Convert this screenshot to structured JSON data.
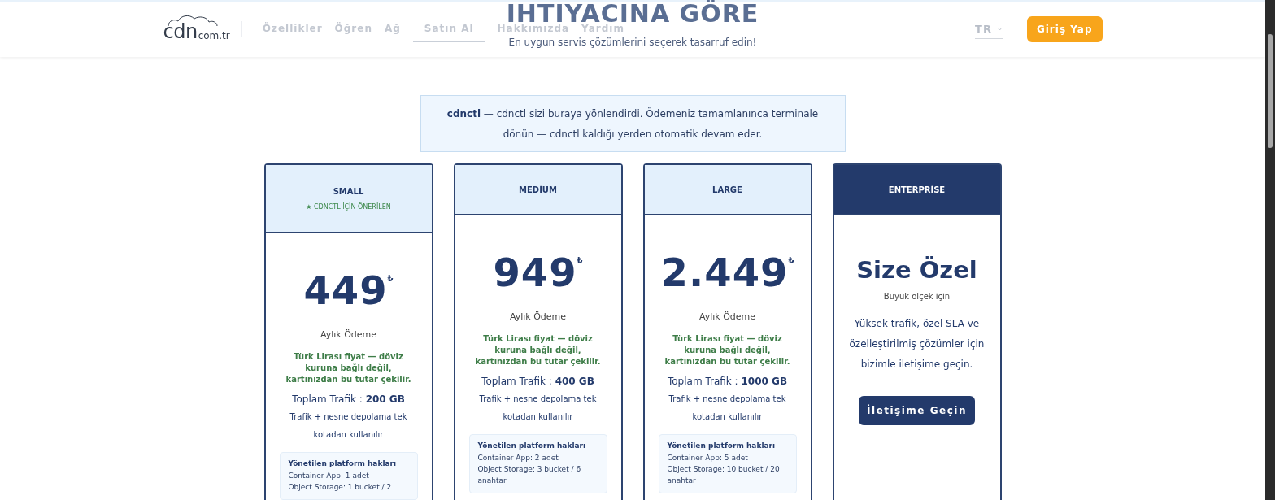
{
  "header": {
    "logo": {
      "text": "cdn",
      "suffix": "com.tr"
    },
    "nav": [
      {
        "label": "Özellikler",
        "selected": false
      },
      {
        "label": "Öğren",
        "selected": false
      },
      {
        "label": "Ağ",
        "selected": false
      },
      {
        "label": "Satın Al",
        "selected": true
      },
      {
        "label": "Hakkımızda",
        "selected": false
      },
      {
        "label": "Yardım",
        "selected": false
      }
    ],
    "language": "TR",
    "login_button": "Giriş Yap"
  },
  "hero": {
    "title": "IHTIYACINA GÖRE",
    "subtitle": "En uygun servis çözümlerini seçerek tasarruf edin!"
  },
  "notice": "**cdnctl** — cdnctl sizi buraya yönlendirdi. Ödemeniz tamamlanınca terminale dönün — cdnctl kaldığı yerden otomatik devam eder.",
  "plans": [
    {
      "kind": "priced",
      "name": "SMALL",
      "badge": "★ CDNCTL İÇİN ÖNERİLEN",
      "price": "449",
      "currency": "₺",
      "period": "Aylık Ödeme",
      "note": "Türk Lirası fiyat — döviz kuruna bağlı değil, kartınızdan bu tutar çekilir.",
      "traffic_label": "Toplam Trafik :",
      "traffic_value": "200 GB",
      "traffic_note": "Trafik + nesne depolama tek kotadan kullanılır",
      "rights_title": "Yönetilen platform hakları",
      "rights": [
        "Container App: 1 adet",
        "Object Storage: 1 bucket / 2"
      ]
    },
    {
      "kind": "priced",
      "name": "MEDİUM",
      "price": "949",
      "currency": "₺",
      "period": "Aylık Ödeme",
      "note": "Türk Lirası fiyat — döviz kuruna bağlı değil, kartınızdan bu tutar çekilir.",
      "traffic_label": "Toplam Trafik :",
      "traffic_value": "400 GB",
      "traffic_note": "Trafik + nesne depolama tek kotadan kullanılır",
      "rights_title": "Yönetilen platform hakları",
      "rights": [
        "Container App: 2 adet",
        "Object Storage: 3 bucket / 6 anahtar"
      ]
    },
    {
      "kind": "priced",
      "name": "LARGE",
      "price": "2.449",
      "currency": "₺",
      "period": "Aylık Ödeme",
      "note": "Türk Lirası fiyat — döviz kuruna bağlı değil, kartınızdan bu tutar çekilir.",
      "traffic_label": "Toplam Trafik :",
      "traffic_value": "1000 GB",
      "traffic_note": "Trafik + nesne depolama tek kotadan kullanılır",
      "rights_title": "Yönetilen platform hakları",
      "rights": [
        "Container App: 5 adet",
        "Object Storage: 10 bucket / 20 anahtar"
      ]
    },
    {
      "kind": "custom",
      "name": "ENTERPRİSE",
      "title": "Size Özel",
      "subtitle": "Büyük ölçek için",
      "description": "Yüksek trafik, özel SLA ve özelleştirilmiş çözümler için bizimle iletişime geçin.",
      "button": "İletişime Geçin"
    }
  ]
}
